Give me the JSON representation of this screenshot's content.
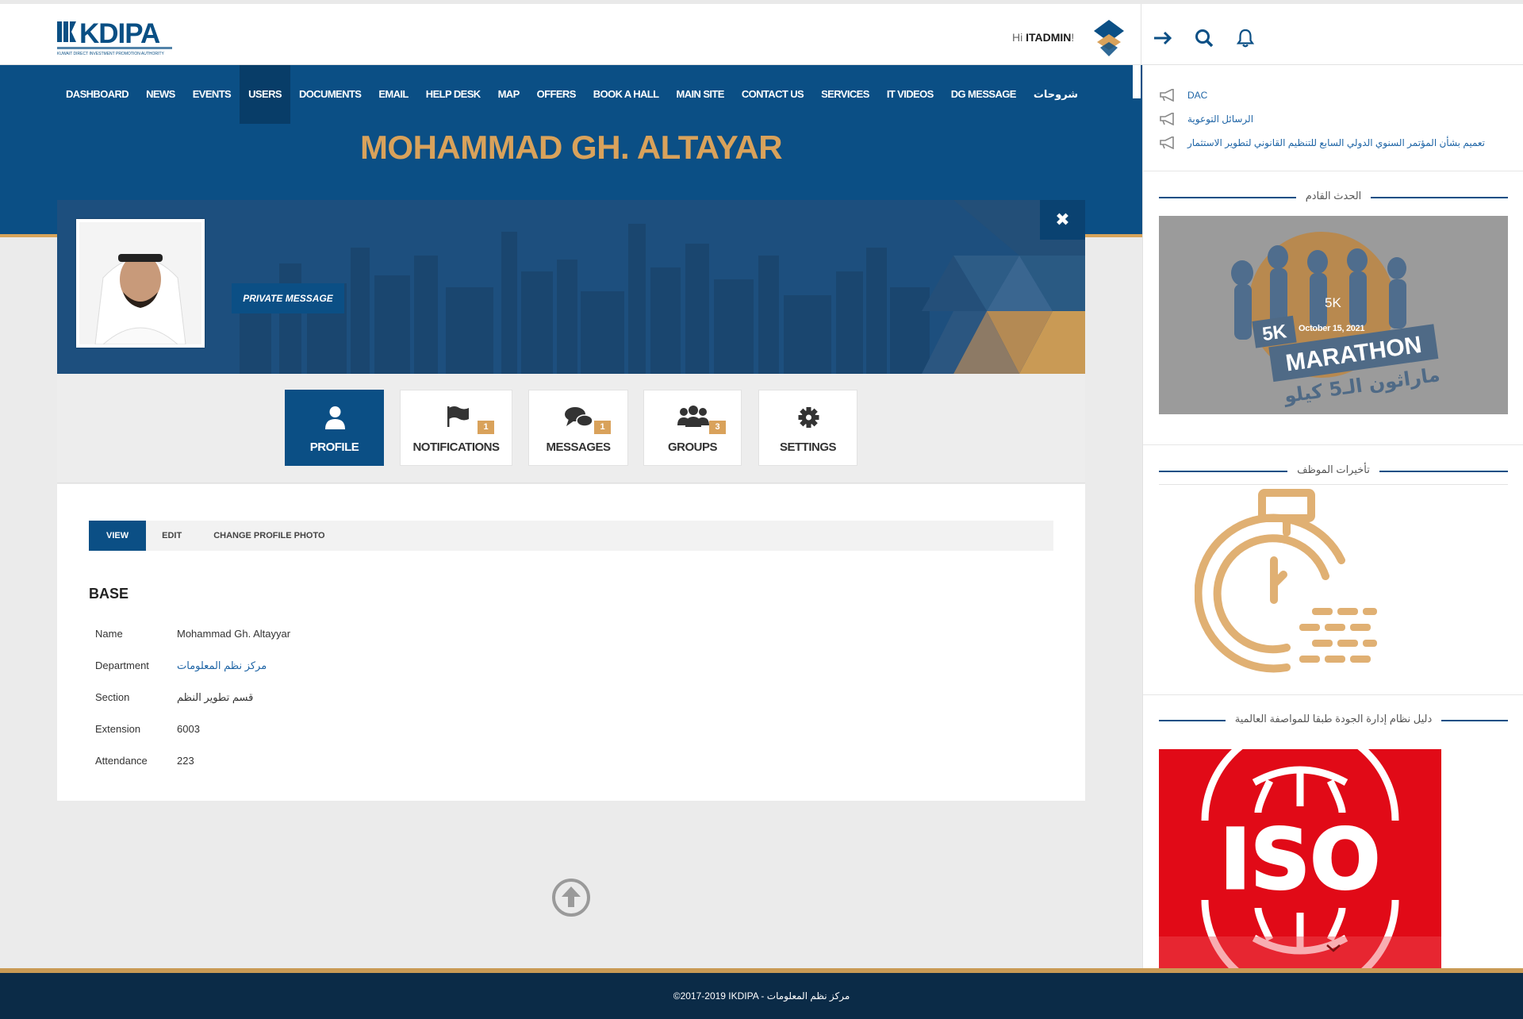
{
  "header": {
    "logo_text": "KDIPA",
    "logo_subtitle": "KUWAIT DIRECT INVESTMENT PROMOTION AUTHORITY",
    "greeting_prefix": "Hi",
    "username": "ITADMIN",
    "greeting_suffix": "!",
    "icons": [
      "logout-arrow-icon",
      "search-icon",
      "bell-icon"
    ]
  },
  "nav": {
    "items": [
      "DASHBOARD",
      "NEWS",
      "EVENTS",
      "USERS",
      "DOCUMENTS",
      "EMAIL",
      "HELP DESK",
      "MAP",
      "OFFERS",
      "BOOK A HALL",
      "MAIN SITE",
      "CONTACT US",
      "SERVICES",
      "IT VIDEOS",
      "DG MESSAGE",
      "شروحات"
    ],
    "active": "USERS"
  },
  "profile": {
    "title": "MOHAMMAD GH. ALTAYAR",
    "private_message_label": "PRIVATE MESSAGE",
    "close_label": "✖"
  },
  "tiles": [
    {
      "label": "PROFILE",
      "icon": "user-icon",
      "badge": null
    },
    {
      "label": "NOTIFICATIONS",
      "icon": "flag-icon",
      "badge": "1"
    },
    {
      "label": "MESSAGES",
      "icon": "chat-bubbles-icon",
      "badge": "1"
    },
    {
      "label": "GROUPS",
      "icon": "group-users-icon",
      "badge": "3"
    },
    {
      "label": "SETTINGS",
      "icon": "gear-icon",
      "badge": null
    }
  ],
  "subtabs": [
    "VIEW",
    "EDIT",
    "CHANGE PROFILE PHOTO"
  ],
  "base": {
    "section_title": "BASE",
    "fields": [
      {
        "label": "Name",
        "value": "Mohammad Gh. Altayyar"
      },
      {
        "label": "Department",
        "value": "مركز نظم المعلومات"
      },
      {
        "label": "Section",
        "value": "قسم تطوير النظم"
      },
      {
        "label": "Extension",
        "value": "6003"
      },
      {
        "label": "Attendance",
        "value": "223"
      }
    ]
  },
  "sidebar": {
    "announcements": [
      "DAC",
      "الرسائل التوعوية",
      "تعميم بشأن المؤتمر السنوي الدولي السابع للتنظيم القانوني لتطوير الاستثمار"
    ],
    "upcoming_event_heading": "الحدث القادم",
    "event": {
      "distance": "5K",
      "date": "October 15, 2021",
      "poster_text": "5K MARATHON",
      "poster_arabic": "ماراثون الـ5 كيلو"
    },
    "delays_heading": "تأخيرات الموظف",
    "quality_heading": "دليل نظام إدارة الجودة طبقا للمواصفة العالمية",
    "iso_text": "ISO"
  },
  "footer": {
    "text": "©2017-2019 IKDIPA - مركز نظم المعلومات"
  },
  "colors": {
    "primary_blue": "#0b4f85",
    "gold": "#d9a25b",
    "footer_navy": "#0b2b47",
    "iso_red": "#e10a17"
  }
}
